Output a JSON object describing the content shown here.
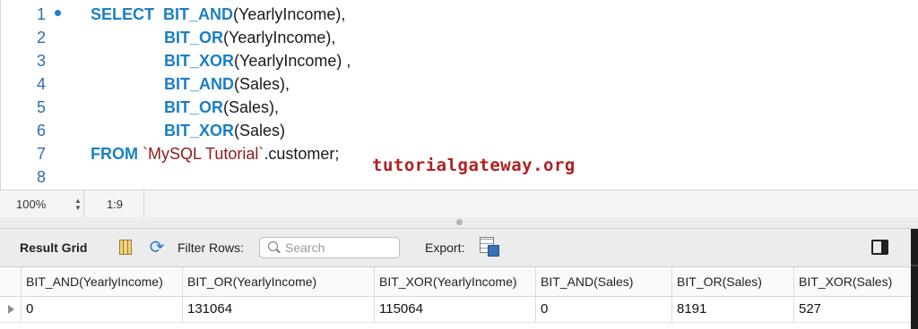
{
  "editor": {
    "line_numbers": [
      "1",
      "2",
      "3",
      "4",
      "5",
      "6",
      "7",
      "8"
    ],
    "lines": [
      {
        "kw": "SELECT  BIT_AND",
        "rest": "(YearlyIncome),"
      },
      {
        "kw": "BIT_OR",
        "rest": "(YearlyIncome),"
      },
      {
        "kw": "BIT_XOR",
        "rest": "(YearlyIncome) ,"
      },
      {
        "kw": "BIT_AND",
        "rest": "(Sales),"
      },
      {
        "kw": "BIT_OR",
        "rest": "(Sales),"
      },
      {
        "kw": "BIT_XOR",
        "rest": "(Sales)"
      }
    ],
    "from_line": {
      "kw": "FROM",
      "str": "`MySQL Tutorial`",
      "rest": ".customer;"
    },
    "watermark": "tutorialgateway.org"
  },
  "statusbar": {
    "zoom": "100%",
    "cursor_position": "1:9"
  },
  "toolbar": {
    "result_grid_label": "Result Grid",
    "filter_rows_label": "Filter Rows:",
    "search_placeholder": "Search",
    "export_label": "Export:"
  },
  "grid": {
    "columns": [
      "BIT_AND(YearlyIncome)",
      "BIT_OR(YearlyIncome)",
      "BIT_XOR(YearlyIncome)",
      "BIT_AND(Sales)",
      "BIT_OR(Sales)",
      "BIT_XOR(Sales)"
    ],
    "rows": [
      [
        "0",
        "131064",
        "115064",
        "0",
        "8191",
        "527"
      ]
    ]
  },
  "icons": {
    "current_line_marker": "bullet-icon",
    "grid_view": "grid-icon",
    "refresh": "refresh-icon",
    "search": "search-icon",
    "export": "export-icon",
    "panel_toggle": "panel-toggle-icon",
    "row_pointer": "row-arrow-icon"
  },
  "colors": {
    "keyword": "#1b7fc4",
    "string": "#8b1a1a",
    "line_number": "#2a6fb0",
    "watermark": "#b02020"
  }
}
